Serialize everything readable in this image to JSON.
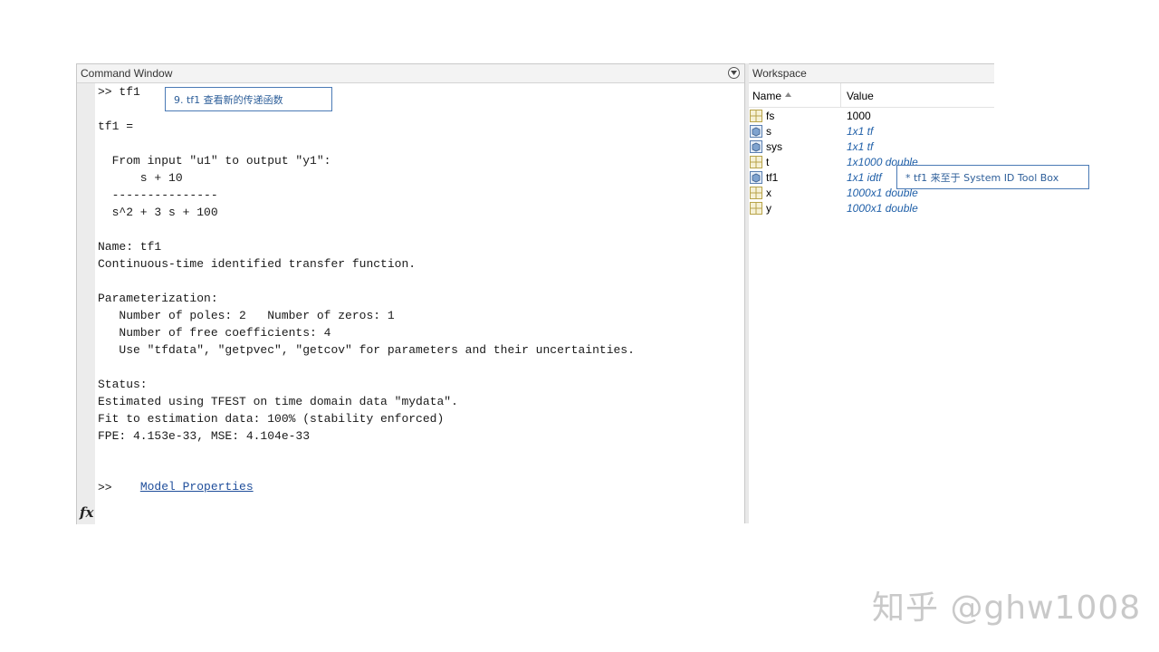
{
  "command_window": {
    "title": "Command Window",
    "lines": [
      ">> tf1",
      "",
      "tf1 =",
      "",
      "  From input \"u1\" to output \"y1\":",
      "      s + 10",
      "  ---------------",
      "  s^2 + 3 s + 100",
      "",
      "Name: tf1",
      "Continuous-time identified transfer function.",
      "",
      "Parameterization:",
      "   Number of poles: 2   Number of zeros: 1",
      "   Number of free coefficients: 4",
      "   Use \"tfdata\", \"getpvec\", \"getcov\" for parameters and their uncertainties.",
      "",
      "Status:",
      "Estimated using TFEST on time domain data \"mydata\".",
      "Fit to estimation data: 100% (stability enforced)",
      "FPE: 4.153e-33, MSE: 4.104e-33",
      ""
    ],
    "link_text": "Model Properties",
    "prompt": ">>",
    "fx_label": "fx"
  },
  "workspace": {
    "title": "Workspace",
    "columns": {
      "name": "Name",
      "value": "Value",
      "sort_icon": "sort-ascending-icon"
    },
    "rows": [
      {
        "name": "fs",
        "value": "1000",
        "icon": "matrix-icon",
        "is_class": false
      },
      {
        "name": "s",
        "value": "1x1 tf",
        "icon": "object-icon",
        "is_class": true
      },
      {
        "name": "sys",
        "value": "1x1 tf",
        "icon": "object-icon",
        "is_class": true
      },
      {
        "name": "t",
        "value": "1x1000 double",
        "icon": "matrix-icon",
        "is_class": true
      },
      {
        "name": "tf1",
        "value": "1x1 idtf",
        "icon": "object-icon",
        "is_class": true
      },
      {
        "name": "x",
        "value": "1000x1 double",
        "icon": "matrix-icon",
        "is_class": true
      },
      {
        "name": "y",
        "value": "1000x1 double",
        "icon": "matrix-icon",
        "is_class": true
      }
    ]
  },
  "annotations": {
    "command_callout": "9. tf1 查看新的传递函数",
    "workspace_callout": "* tf1 来至于 System ID Tool Box"
  },
  "watermark": "知乎 @ghw1008",
  "colors": {
    "link": "#1f4e9b",
    "workspace_class_value": "#1f5fa8",
    "callout_border": "#4a7ab5",
    "callout_text": "#2e5f9a"
  }
}
